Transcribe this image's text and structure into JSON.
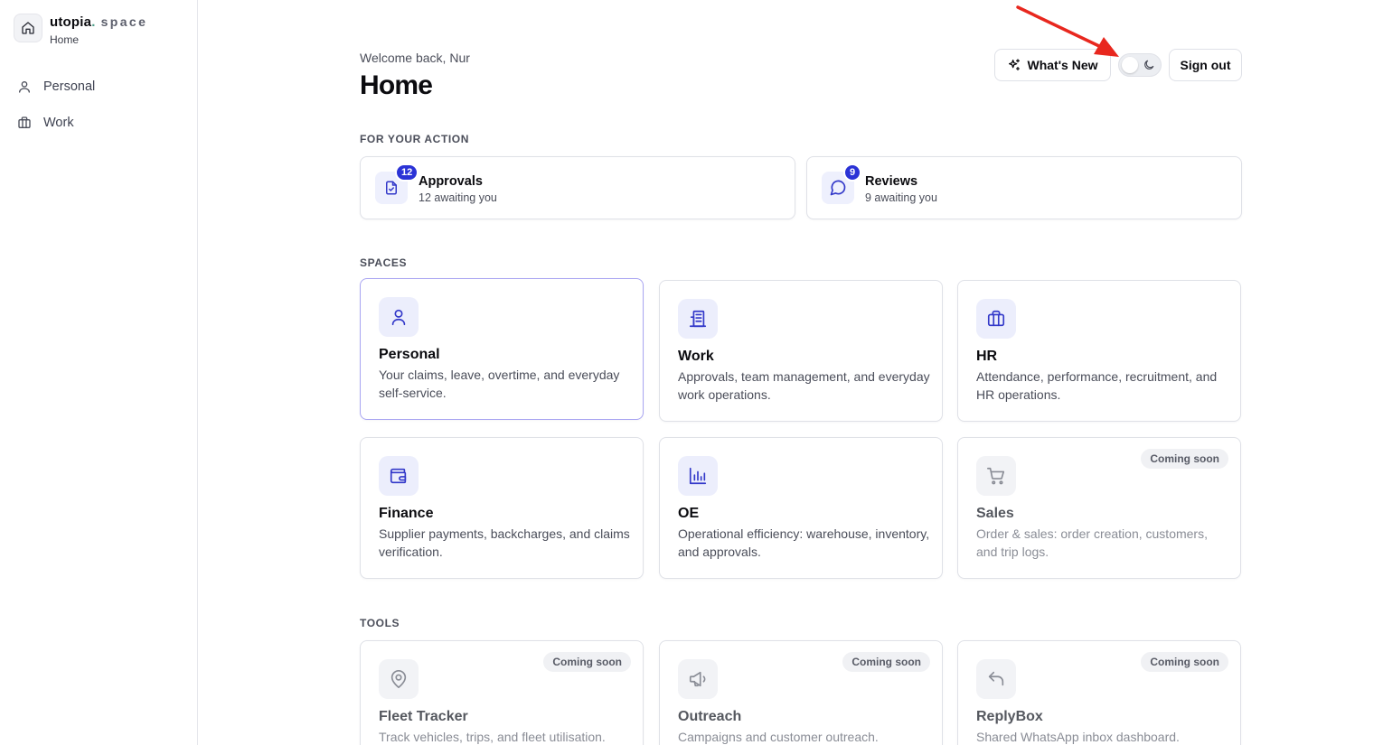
{
  "brand": {
    "name": "utopia",
    "dot": ".",
    "suffix": "space",
    "subtitle": "Home"
  },
  "sidebar": {
    "items": [
      {
        "label": "Personal",
        "icon": "user-icon"
      },
      {
        "label": "Work",
        "icon": "briefcase-icon"
      }
    ]
  },
  "header": {
    "welcome": "Welcome back, Nur",
    "title": "Home",
    "whats_new": "What's New",
    "sign_out": "Sign out",
    "theme_toggle": "light"
  },
  "for_action": {
    "label": "FOR YOUR ACTION",
    "cards": [
      {
        "title": "Approvals",
        "subtitle": "12 awaiting you",
        "count": "12",
        "icon": "file-check-icon"
      },
      {
        "title": "Reviews",
        "subtitle": "9 awaiting you",
        "count": "9",
        "icon": "message-circle-icon"
      }
    ]
  },
  "spaces": {
    "label": "SPACES",
    "cards": [
      {
        "title": "Personal",
        "desc": "Your claims, leave, overtime, and everyday self-service.",
        "icon": "user-icon"
      },
      {
        "title": "Work",
        "desc": "Approvals, team management, and everyday work operations.",
        "icon": "building-icon"
      },
      {
        "title": "HR",
        "desc": "Attendance, performance, recruitment, and HR operations.",
        "icon": "briefcase-icon"
      },
      {
        "title": "Finance",
        "desc": "Supplier payments, backcharges, and claims verification.",
        "icon": "wallet-icon"
      },
      {
        "title": "OE",
        "desc": "Operational efficiency: warehouse, inventory, and approvals.",
        "icon": "bar-chart-icon"
      },
      {
        "title": "Sales",
        "desc": "Order & sales: order creation, customers, and trip logs.",
        "icon": "cart-icon",
        "badge": "Coming soon"
      }
    ]
  },
  "tools": {
    "label": "TOOLS",
    "cards": [
      {
        "title": "Fleet Tracker",
        "desc": "Track vehicles, trips, and fleet utilisation.",
        "icon": "map-pin-icon",
        "badge": "Coming soon"
      },
      {
        "title": "Outreach",
        "desc": "Campaigns and customer outreach.",
        "icon": "megaphone-icon",
        "badge": "Coming soon"
      },
      {
        "title": "ReplyBox",
        "desc": "Shared WhatsApp inbox dashboard.",
        "icon": "reply-icon",
        "badge": "Coming soon"
      }
    ]
  },
  "colors": {
    "accent": "#2b33d6",
    "icon_tint": "#3238c9",
    "annotation": "#e8271e"
  }
}
